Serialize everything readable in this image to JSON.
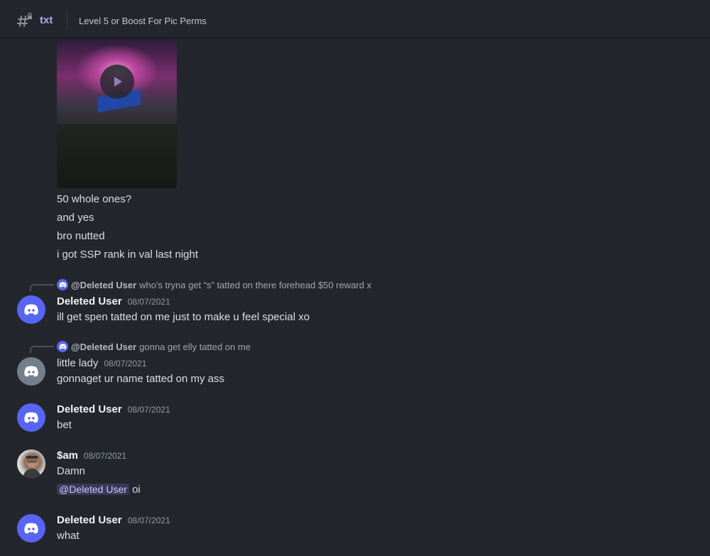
{
  "header": {
    "channel_name": "txt",
    "topic": "Level 5 or Boost For Pic Perms"
  },
  "continued_messages": [
    "50 whole ones?",
    "and yes",
    "bro nutted",
    "i got SSP rank in val last night"
  ],
  "messages": [
    {
      "reply_to_author": "@Deleted User",
      "reply_to_text": "who's tryna get “s” tatted on there forehead $50 reward x",
      "author": "Deleted User",
      "timestamp": "08/07/2021",
      "lines": [
        "ill get spen tatted on me just to make u feel special xo"
      ]
    },
    {
      "reply_to_author": "@Deleted User",
      "reply_to_text": "gonna get elly tatted on me",
      "author": "little lady",
      "timestamp": "08/07/2021",
      "lines": [
        "gonnaget ur name tatted on my ass"
      ]
    },
    {
      "author": "Deleted User",
      "timestamp": "08/07/2021",
      "lines": [
        "bet"
      ]
    },
    {
      "author": "$am",
      "timestamp": "08/07/2021",
      "lines": [
        "Damn"
      ],
      "mention": "@Deleted User",
      "mention_suffix": "oi"
    },
    {
      "author": "Deleted User",
      "timestamp": "08/07/2021",
      "lines": [
        "what"
      ]
    }
  ],
  "colors": {
    "background": "#24262d",
    "blurple": "#5865f2",
    "channel_accent": "#b9a4f5"
  },
  "icons": {
    "channel": "locked-text-channel-icon",
    "play": "play-icon",
    "avatar": "discord-logo-icon"
  }
}
